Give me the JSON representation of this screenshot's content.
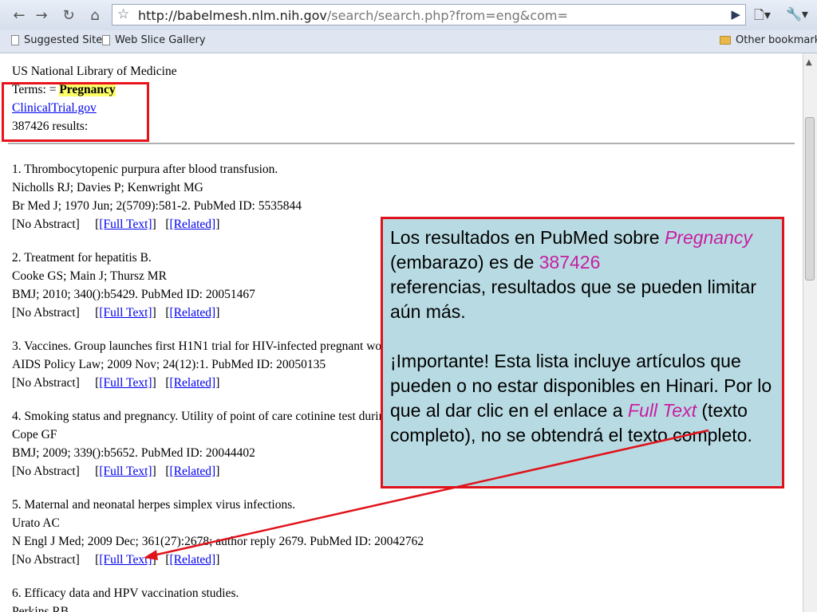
{
  "browser": {
    "url_host": "http://babelmesh.nlm.nih.gov",
    "url_path": "/search/search.php?from=eng&com=",
    "bookmarks": {
      "suggested": "Suggested Sites",
      "webslice": "Web Slice Gallery",
      "other": "Other bookmarks"
    }
  },
  "page": {
    "org": "US National Library of Medicine",
    "terms_label": "Terms: = ",
    "terms_value": "Pregnancy",
    "clinical_link": "ClinicalTrial.gov",
    "results_count": "387426 results:",
    "results": [
      {
        "title": "1. Thrombocytopenic purpura after blood transfusion.",
        "authors": "Nicholls RJ; Davies P; Kenwright MG",
        "citation": "Br Med J; 1970 Jun; 2(5709):581-2. PubMed ID: 5535844"
      },
      {
        "title": "2. Treatment for hepatitis B.",
        "authors": "Cooke GS; Main J; Thursz MR",
        "citation": "BMJ; 2010; 340():b5429. PubMed ID: 20051467"
      },
      {
        "title": "3. Vaccines. Group launches first H1N1 trial for HIV-infected pregnant wome",
        "authors": "",
        "citation": "AIDS Policy Law; 2009 Nov; 24(12):1. PubMed ID: 20050135"
      },
      {
        "title": "4. Smoking status and pregnancy. Utility of point of care cotinine test during pr",
        "authors": "Cope GF",
        "citation": "BMJ; 2009; 339():b5652. PubMed ID: 20044402"
      },
      {
        "title": "5. Maternal and neonatal herpes simplex virus infections.",
        "authors": "Urato AC",
        "citation": "N Engl J Med; 2009 Dec; 361(27):2678; author reply 2679. PubMed ID: 20042762"
      },
      {
        "title": "6. Efficacy data and HPV vaccination studies.",
        "authors": "Perkins RB",
        "citation": ""
      }
    ],
    "no_abstract": "[No Abstract]",
    "full_text": "[Full Text]",
    "related": "[Related]"
  },
  "callout": {
    "p1_a": "Los resultados en PubMed sobre ",
    "p1_term": "Pregnancy",
    "p1_b": " (embarazo) es de ",
    "p1_num": "387426",
    "p1_c": "referencias, resultados que se pueden limitar aún más.",
    "p2_a": "¡Importante! Esta lista incluye artículos que pueden o no estar disponibles en Hinari. Por lo que al dar clic en el enlace a ",
    "p2_term": "Full Text",
    "p2_b": " (texto completo), no se obtendrá el texto completo."
  },
  "colors": {
    "highlight_text": "#c71ea0",
    "annotation_red": "#e0121b",
    "callout_bg": "#b8dbe3",
    "link": "#0000ee"
  }
}
